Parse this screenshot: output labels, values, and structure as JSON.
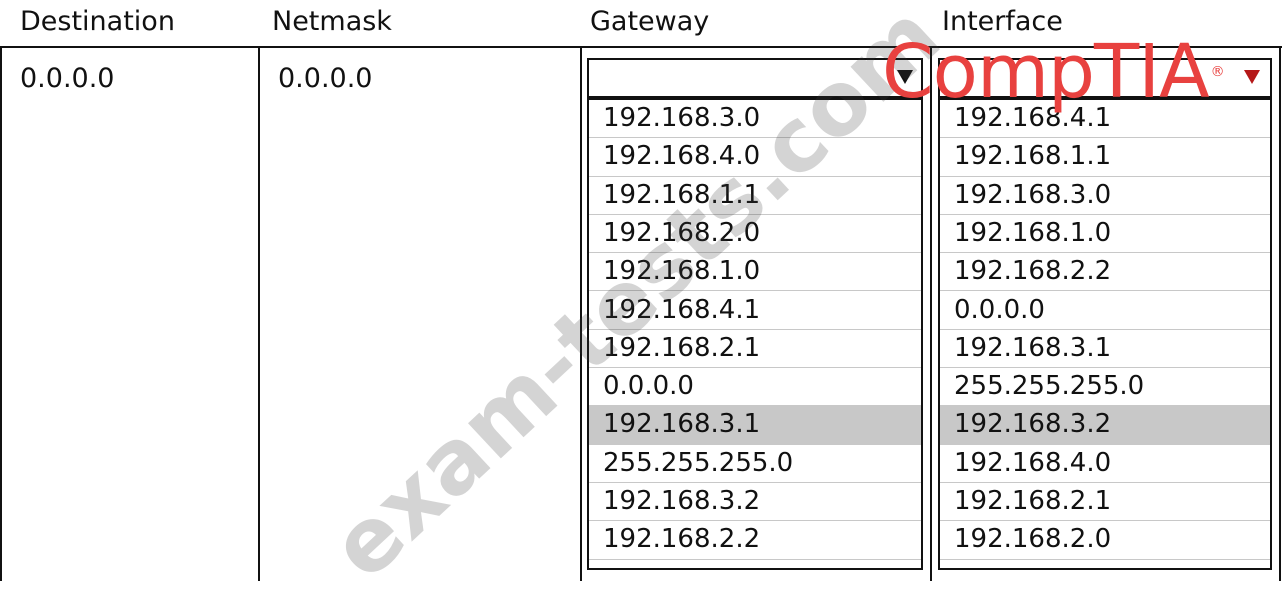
{
  "headers": {
    "destination": "Destination",
    "netmask": "Netmask",
    "gateway": "Gateway",
    "interface": "Interface"
  },
  "row": {
    "destination_value": "0.0.0.0",
    "netmask_value": "0.0.0.0",
    "gateway_selected": "",
    "interface_selected": ""
  },
  "gateway_options": [
    "192.168.3.0",
    "192.168.4.0",
    "192.168.1.1",
    "192.168.2.0",
    "192.168.1.0",
    "192.168.4.1",
    "192.168.2.1",
    "0.0.0.0",
    "192.168.3.1",
    "255.255.255.0",
    "192.168.3.2",
    "192.168.2.2"
  ],
  "gateway_highlighted": "192.168.3.1",
  "interface_options": [
    "192.168.4.1",
    "192.168.1.1",
    "192.168.3.0",
    "192.168.1.0",
    "192.168.2.2",
    "0.0.0.0",
    "192.168.3.1",
    "255.255.255.0",
    "192.168.3.2",
    "192.168.4.0",
    "192.168.2.1",
    "192.168.2.0"
  ],
  "interface_highlighted": "192.168.3.2",
  "watermark": "exam-tests.com",
  "logo": {
    "text": "CompTIA",
    "mark": "®"
  },
  "colors": {
    "logo": "#e8413f",
    "highlight": "#c8c8c8",
    "interface_arrow": "#b51818"
  },
  "icons": {
    "dropdown_arrow": "chevron-down-icon"
  }
}
